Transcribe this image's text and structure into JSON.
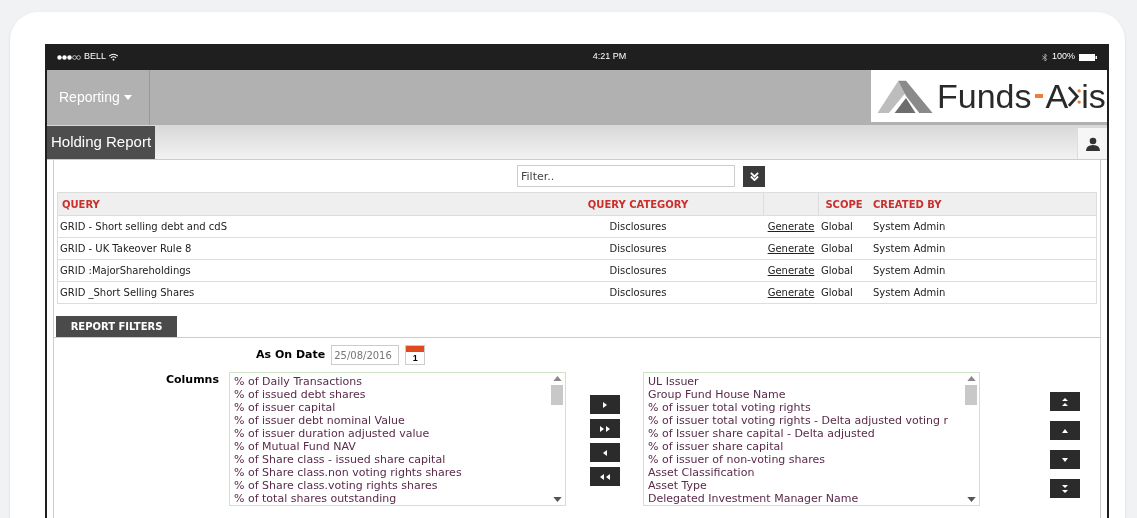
{
  "status_bar": {
    "carrier": "BELL",
    "time": "4:21 PM",
    "battery": "100%"
  },
  "nav": {
    "menu": "Reporting",
    "logo": {
      "part_1": "Funds",
      "part_2": "A",
      "part_3": "is"
    }
  },
  "page_title": "Holding Report",
  "filter": {
    "placeholder": "Filter.."
  },
  "table": {
    "columns": [
      "QUERY",
      "QUERY CATEGORY",
      "SCOPE",
      "CREATED BY"
    ],
    "rows": [
      {
        "query": "GRID - Short selling debt and cdS",
        "category": "Disclosures",
        "action": "Generate",
        "scope": "Global",
        "created_by": "System Admin"
      },
      {
        "query": "GRID - UK Takeover Rule 8",
        "category": "Disclosures",
        "action": "Generate",
        "scope": "Global",
        "created_by": "System Admin"
      },
      {
        "query": "GRID :MajorShareholdings",
        "category": "Disclosures",
        "action": "Generate",
        "scope": "Global",
        "created_by": "System Admin"
      },
      {
        "query": "GRID _Short Selling Shares",
        "category": "Disclosures",
        "action": "Generate",
        "scope": "Global",
        "created_by": "System Admin"
      }
    ]
  },
  "report_filters": {
    "tab": "REPORT FILTERS",
    "date_label": "As On Date",
    "date_value": "25/08/2016",
    "calendar_day": "1",
    "columns_label": "Columns",
    "available_columns": [
      "% of Daily Transactions",
      "% of issued debt shares",
      "% of issuer capital",
      "% of issuer debt nominal Value",
      "% of issuer duration adjusted value",
      "% of Mutual Fund NAV",
      "% of Share class - issued share capital",
      "% of Share class.non voting rights shares",
      "% of Share class.voting rights shares",
      "% of total shares outstanding"
    ],
    "selected_columns": [
      "UL Issuer",
      "Group Fund House Name",
      "% of issuer total voting rights",
      "% of issuer total voting rights - Delta adjusted voting r",
      "% of Issuer share capital - Delta adjusted",
      "% of issuer share capital",
      "% of issuer of non-voting shares",
      "Asset Classification",
      "Asset Type",
      "Delegated Investment Manager Name"
    ]
  }
}
